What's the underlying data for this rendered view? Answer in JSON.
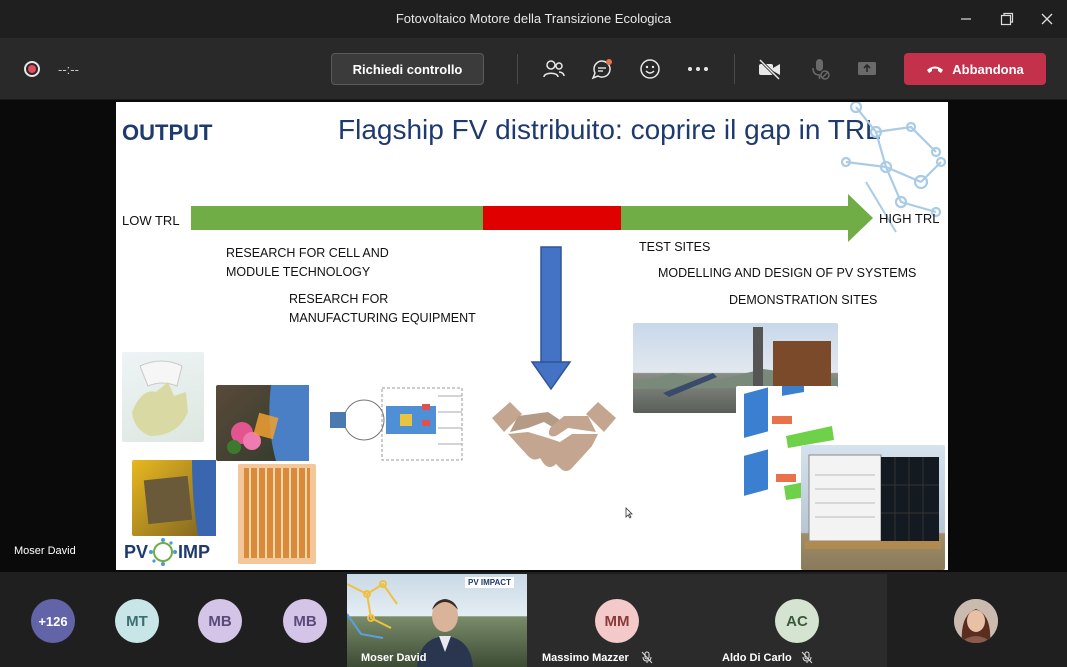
{
  "window": {
    "title": "Fotovoltaico Motore della Transizione Ecologica"
  },
  "toolbar": {
    "timer": "--:--",
    "request_control_label": "Richiedi controllo",
    "leave_label": "Abbandona",
    "icons": [
      "participants-icon",
      "chat-icon",
      "raise-hand-icon",
      "more-icon",
      "camera-off-icon",
      "mic-off-icon",
      "share-icon"
    ]
  },
  "presenter": {
    "name": "Moser David"
  },
  "slide": {
    "corner_title": "OUTPUT",
    "title": "Flagship FV distribuito: coprire il gap in TRL",
    "low_trl": "LOW TRL",
    "high_trl": "HIGH TRL",
    "research_cell_1": "RESEARCH FOR CELL AND",
    "research_cell_2": "MODULE TECHNOLOGY",
    "research_mfg_1": "RESEARCH FOR",
    "research_mfg_2": "MANUFACTURING EQUIPMENT",
    "test_sites": "TEST SITES",
    "modelling": "MODELLING AND DESIGN OF PV SYSTEMS",
    "demo_sites": "DEMONSTRATION SITES",
    "logo_left": "PV",
    "logo_right": "IMP",
    "colors": {
      "green": "#70ad47",
      "red": "#e00000",
      "blue": "#4472c4",
      "title": "#1e3a6e"
    }
  },
  "participants": {
    "overflow": "+126",
    "mt": "MT",
    "mb1": "MB",
    "mb2": "MB",
    "video_name": "Moser David",
    "video_logo": "PV IMPACT",
    "massimo_initials": "MM",
    "massimo_name": "Massimo Mazzer",
    "aldo_initials": "AC",
    "aldo_name": "Aldo Di Carlo"
  },
  "theme": {
    "leave": "#c4314b",
    "accent": "#6264a7"
  }
}
